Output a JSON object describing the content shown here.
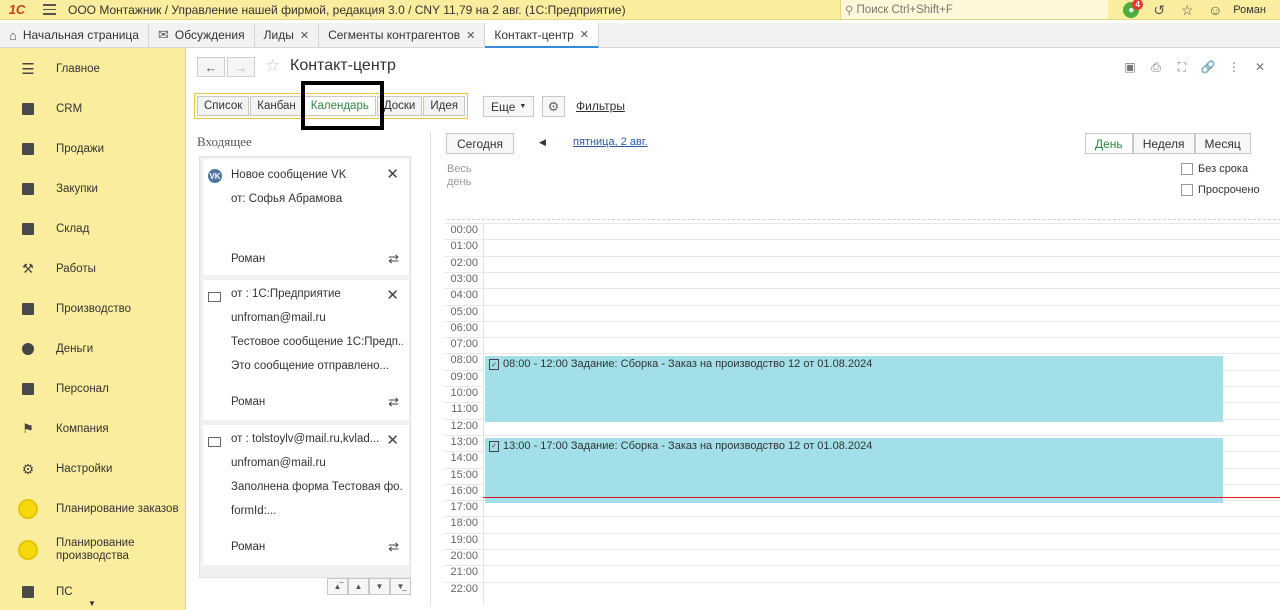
{
  "app": {
    "logo": "1С",
    "title": "ООО Монтажник / Управление нашей фирмой, редакция 3.0 / CNY 11,79 на 2 авг.  (1С:Предприятие)",
    "search_placeholder": "Поиск Ctrl+Shift+F",
    "notifications_count": "4",
    "user": "Роман"
  },
  "tabs": [
    {
      "label": "Начальная страница"
    },
    {
      "label": "Обсуждения"
    },
    {
      "label": "Лиды"
    },
    {
      "label": "Сегменты контрагентов"
    },
    {
      "label": "Контакт-центр"
    }
  ],
  "sidebar": {
    "items": [
      {
        "label": "Главное",
        "icon": "menu-icon"
      },
      {
        "label": "CRM",
        "icon": "crm-icon"
      },
      {
        "label": "Продажи",
        "icon": "basket-icon"
      },
      {
        "label": "Закупки",
        "icon": "cart-icon"
      },
      {
        "label": "Склад",
        "icon": "warehouse-icon"
      },
      {
        "label": "Работы",
        "icon": "wrench-icon"
      },
      {
        "label": "Производство",
        "icon": "factory-icon"
      },
      {
        "label": "Деньги",
        "icon": "coin-icon"
      },
      {
        "label": "Персонал",
        "icon": "people-icon"
      },
      {
        "label": "Компания",
        "icon": "flag-icon"
      },
      {
        "label": "Настройки",
        "icon": "gear-icon"
      },
      {
        "label": "Планирование заказов",
        "icon": "yellow-circle-icon"
      },
      {
        "label": "Планирование производства",
        "icon": "yellow-circle-icon"
      },
      {
        "label": "ПС",
        "icon": "ps-icon"
      }
    ]
  },
  "page": {
    "title": "Контакт-центр",
    "views": [
      "Список",
      "Канбан",
      "Календарь",
      "Доски",
      "Идея"
    ],
    "active_view": "Календарь",
    "more_label": "Еще",
    "filters_label": "Фильтры"
  },
  "inbox": {
    "title": "Входящее",
    "cards": [
      {
        "icon": "vk-icon",
        "lines": [
          "Новое сообщение VK",
          "от: Софья Абрамова"
        ],
        "user": "Роман"
      },
      {
        "icon": "mail-icon",
        "lines": [
          "от : 1С:Предприятие",
          "unfroman@mail.ru",
          "Тестовое сообщение 1С:Предп...",
          "Это сообщение отправлено..."
        ],
        "user": "Роман"
      },
      {
        "icon": "mail-icon",
        "lines": [
          "от : tolstoylv@mail.ru,kvlad...",
          "unfroman@mail.ru",
          "Заполнена форма Тестовая фо...",
          "formId:..."
        ],
        "user": "Роман"
      }
    ]
  },
  "calendar": {
    "today_label": "Сегодня",
    "date_label": "пятница, 2 авг.",
    "periods": [
      "День",
      "Неделя",
      "Месяц"
    ],
    "active_period": "День",
    "allday_label": "Весь день",
    "checkbox_no_deadline": "Без срока",
    "checkbox_overdue": "Просрочено",
    "hours": [
      "00:00",
      "01:00",
      "02:00",
      "03:00",
      "04:00",
      "05:00",
      "06:00",
      "07:00",
      "08:00",
      "09:00",
      "10:00",
      "11:00",
      "12:00",
      "13:00",
      "14:00",
      "15:00",
      "16:00",
      "17:00",
      "18:00",
      "19:00",
      "20:00",
      "21:00",
      "22:00"
    ],
    "events": [
      {
        "text": "08:00 - 12:00 Задание: Сборка - Заказ на производство 12 от 01.08.2024",
        "start": 8,
        "end": 12
      },
      {
        "text": "13:00 - 17:00 Задание: Сборка - Заказ на производство 12 от 01.08.2024",
        "start": 13,
        "end": 17
      }
    ],
    "now_hour": 16.6,
    "event_color": "#a3dfe8"
  }
}
